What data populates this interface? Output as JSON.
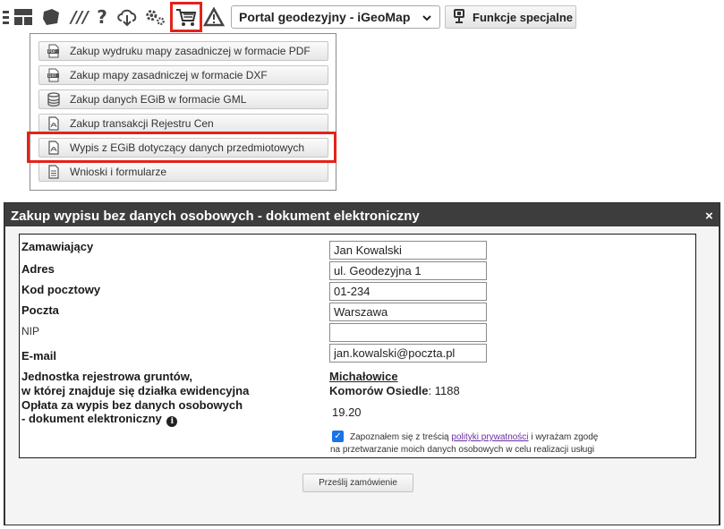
{
  "toolbar": {
    "icons": [
      "list-icon",
      "layout-icon",
      "shape-icon",
      "tools-icon",
      "help-icon",
      "cloud-download-icon",
      "settings-icon",
      "cart-icon",
      "warning-icon"
    ],
    "help_glyph": "?",
    "slashes_glyph": "///",
    "portal_select": {
      "value": "Portal geodezyjny - iGeoMap"
    },
    "special_functions_label": "Funkcje specjalne",
    "highlight_color": "#e2231a"
  },
  "menu": {
    "items": [
      {
        "label": "Zakup wydruku mapy zasadniczej w formacie PDF",
        "icon": "pdf-icon"
      },
      {
        "label": "Zakup mapy zasadniczej w formacie DXF",
        "icon": "dxf-icon"
      },
      {
        "label": "Zakup danych EGiB w formacie GML",
        "icon": "database-icon"
      },
      {
        "label": "Zakup transakcji Rejestru Cen",
        "icon": "document-pdf-icon"
      },
      {
        "label": "Wypis z EGiB dotyczący danych przedmiotowych",
        "icon": "document-pdf-icon"
      },
      {
        "label": "Wnioski i formularze",
        "icon": "form-icon"
      }
    ]
  },
  "dialog": {
    "title": "Zakup wypisu bez danych osobowych - dokument elektroniczny",
    "close_glyph": "×",
    "form": {
      "orderer_label": "Zamawiający",
      "orderer_value": "Jan Kowalski",
      "address_label": "Adres",
      "address_value": "ul. Geodezyjna 1",
      "postcode_label": "Kod pocztowy",
      "postcode_value": "01-234",
      "post_label": "Poczta",
      "post_value": "Warszawa",
      "nip_label": "NIP",
      "nip_value": "",
      "email_label": "E-mail",
      "email_value": "jan.kowalski@poczta.pl",
      "unit_label_line1": "Jednostka rejestrowa gruntów,",
      "unit_label_line2": "w której znajduje się działka ewidencyjna",
      "unit_name": "Michałowice",
      "precinct_name": "Komorów Osiedle",
      "parcel_number": ": 1188",
      "fee_label_line1": "Opłata za wypis bez danych osobowych",
      "fee_label_line2": "- dokument elektroniczny",
      "fee_info_glyph": "i",
      "fee_value": "19.20",
      "consent_checked": true,
      "consent_text_before": "Zapoznałem się z treścią ",
      "consent_link": "polityki prywatności",
      "consent_text_after": " i wyrażam zgodę",
      "consent_text_line2": "na przetwarzanie moich danych osobowych w celu realizacji usługi"
    },
    "submit_label": "Prześlij zamówienie"
  }
}
